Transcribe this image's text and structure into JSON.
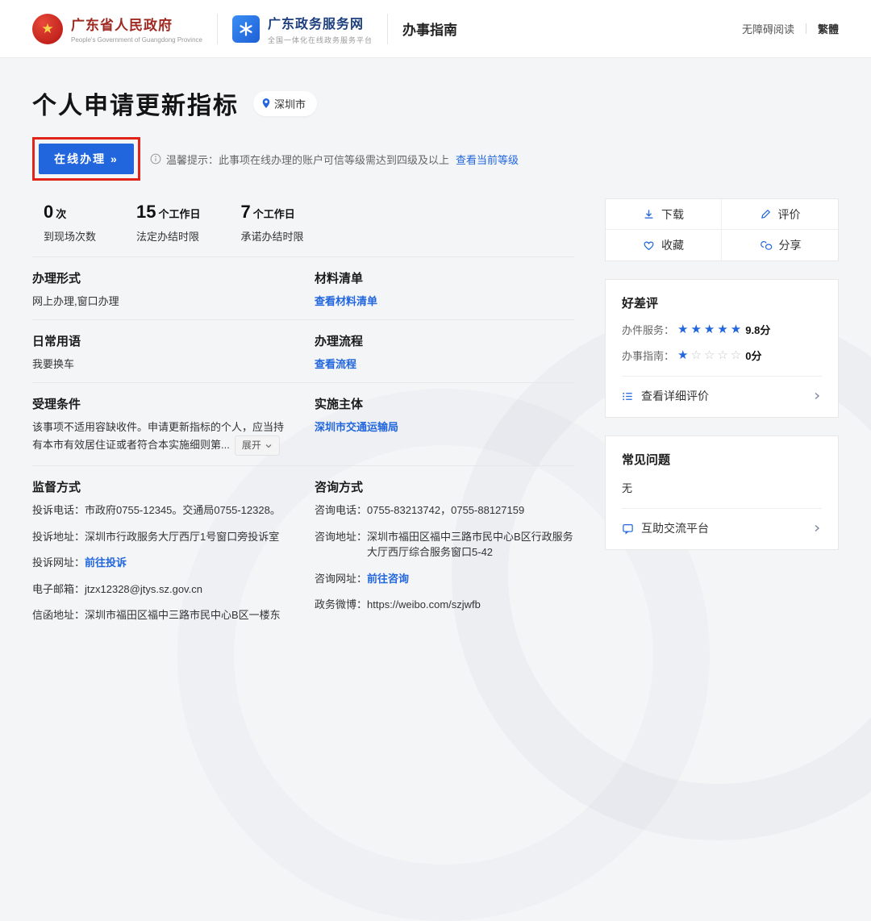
{
  "colors": {
    "primary": "#2166dd",
    "annotation_red": "#e2231a",
    "star_empty": "#c8c8c8",
    "gov_red": "#9e2a22"
  },
  "header": {
    "gov": {
      "name": "广东省人民政府",
      "subtitle": "People's Government of Guangdong Province"
    },
    "portal": {
      "name": "广东政务服务网",
      "subtitle": "全国一体化在线政务服务平台"
    },
    "nav_title": "办事指南",
    "accessibility_label": "无障碍阅读",
    "lang_label": "繁體"
  },
  "hero": {
    "title": "个人申请更新指标",
    "city_badge": "深圳市",
    "online_button_label": "在线办理 »",
    "tip_text": "温馨提示：此事项在线办理的账户可信等级需达到四级及以上",
    "tip_link": "查看当前等级"
  },
  "stats": [
    {
      "value": "0",
      "unit": "次",
      "label": "到现场次数"
    },
    {
      "value": "15",
      "unit": "个工作日",
      "label": "法定办结时限"
    },
    {
      "value": "7",
      "unit": "个工作日",
      "label": "承诺办结时限"
    }
  ],
  "info": {
    "form": {
      "title": "办理形式",
      "content": "网上办理,窗口办理"
    },
    "materials": {
      "title": "材料清单",
      "link": "查看材料清单"
    },
    "daily": {
      "title": "日常用语",
      "content": "我要换车"
    },
    "process": {
      "title": "办理流程",
      "link": "查看流程"
    },
    "conditions": {
      "title": "受理条件",
      "content": "该事项不适用容缺收件。申请更新指标的个人，应当持有本市有效居住证或者符合本实施细则第...",
      "expand_label": "展开"
    },
    "agency": {
      "title": "实施主体",
      "link": "深圳市交通运输局"
    },
    "supervision": {
      "title": "监督方式",
      "items": [
        {
          "label": "投诉电话：",
          "text": "市政府0755-12345。交通局0755-12328。"
        },
        {
          "label": "投诉地址：",
          "text": "深圳市行政服务大厅西厅1号窗口旁投诉室"
        },
        {
          "label": "投诉网址：",
          "link": "前往投诉"
        },
        {
          "label": "电子邮箱：",
          "text": "jtzx12328@jtys.sz.gov.cn"
        },
        {
          "label": "信函地址：",
          "text": "深圳市福田区福中三路市民中心B区一楼东"
        }
      ]
    },
    "consult": {
      "title": "咨询方式",
      "items": [
        {
          "label": "咨询电话：",
          "text": "0755-83213742，0755-88127159"
        },
        {
          "label": "咨询地址：",
          "text": "深圳市福田区福中三路市民中心B区行政服务大厅西厅综合服务窗口5-42"
        },
        {
          "label": "咨询网址：",
          "link": "前往咨询"
        },
        {
          "label": "政务微博：",
          "text": "https://weibo.com/szjwfb"
        }
      ]
    }
  },
  "sidebar": {
    "actions": [
      {
        "label": "下载"
      },
      {
        "label": "评价"
      },
      {
        "label": "收藏"
      },
      {
        "label": "分享"
      }
    ],
    "rating": {
      "title": "好差评",
      "rows": [
        {
          "label": "办件服务：",
          "stars_filled": "★★★★★",
          "stars_empty": "",
          "score": "9.8分"
        },
        {
          "label": "办事指南：",
          "stars_filled": "★",
          "stars_empty": "☆☆☆☆",
          "score": "0分"
        }
      ],
      "detail_link": "查看详细评价"
    },
    "faq": {
      "title": "常见问题",
      "empty_text": "无",
      "link": "互助交流平台"
    }
  }
}
